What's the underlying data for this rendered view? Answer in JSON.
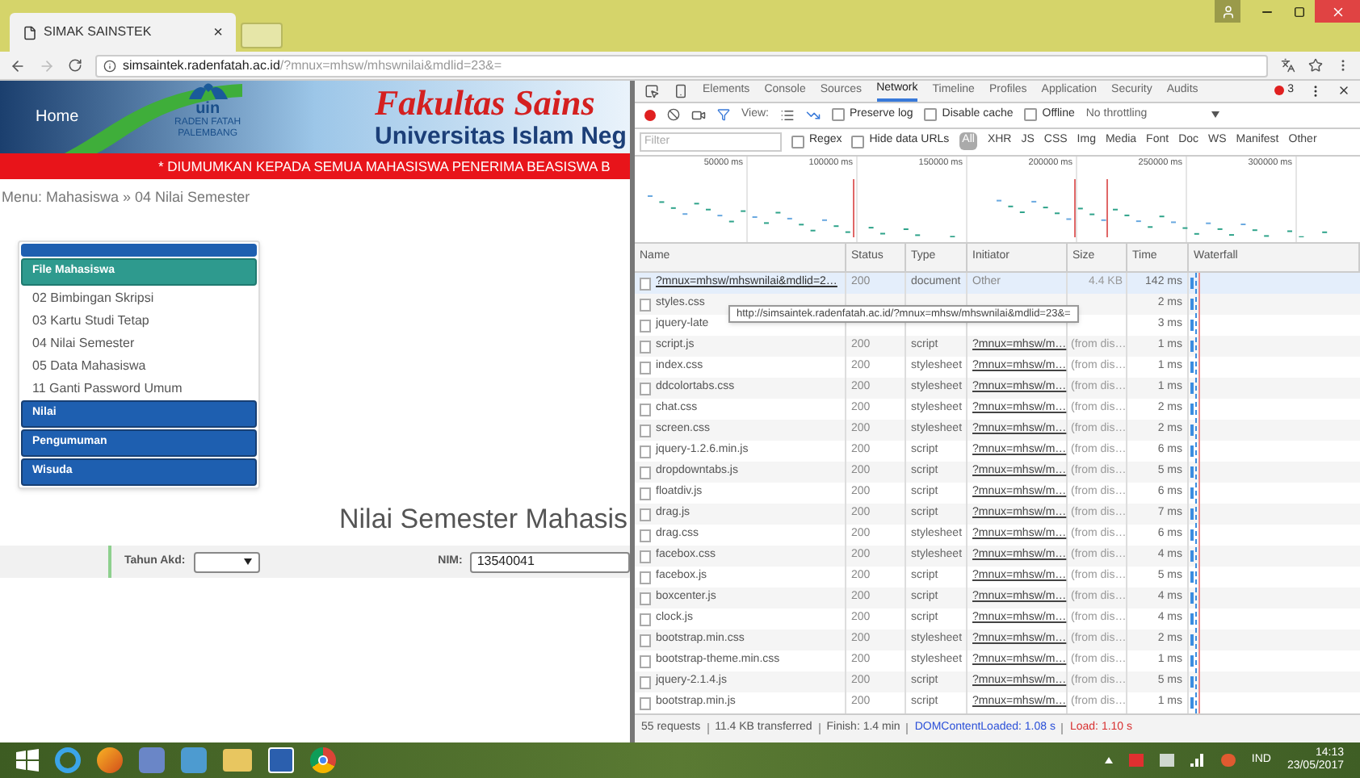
{
  "browser": {
    "tab": {
      "title": "SIMAK SAINSTEK",
      "close": "×"
    },
    "address": {
      "host": "simsaintek.radenfatah.ac.id",
      "path": "/?mnux=mhsw/mhswnilai&mdlid=23&="
    }
  },
  "page": {
    "banner": {
      "home": "Home",
      "logo": [
        "uin",
        "RADEN FATAH",
        "PALEMBANG"
      ],
      "title": "Fakultas Sains",
      "subtitle": "Universitas Islam Neg"
    },
    "marquee": "* DIUMUMKAN KEPADA SEMUA MAHASISWA PENERIMA BEASISWA B",
    "breadcrumb": "Menu: Mahasiswa » 04 Nilai Semester",
    "sidebar": [
      {
        "label": "File Mahasiswa",
        "expanded": true,
        "children": [
          "02 Bimbingan Skripsi",
          "03 Kartu Studi Tetap",
          "04 Nilai Semester",
          "05 Data Mahasiswa",
          "11 Ganti Password Umum"
        ]
      },
      {
        "label": "Nilai",
        "expanded": false
      },
      {
        "label": "Pengumuman",
        "expanded": false
      },
      {
        "label": "Wisuda",
        "expanded": false
      }
    ],
    "heading": "Nilai Semester Mahasis",
    "form": {
      "year_label": "Tahun Akd:",
      "nim_label": "NIM:",
      "nim_value": "13540041"
    }
  },
  "devtools": {
    "tabs": [
      {
        "label": "Elements",
        "selected": false
      },
      {
        "label": "Console",
        "selected": false
      },
      {
        "label": "Sources",
        "selected": false
      },
      {
        "label": "Network",
        "selected": true
      },
      {
        "label": "Timeline",
        "selected": false
      },
      {
        "label": "Profiles",
        "selected": false
      },
      {
        "label": "Application",
        "selected": false
      },
      {
        "label": "Security",
        "selected": false
      },
      {
        "label": "Audits",
        "selected": false
      }
    ],
    "error_count": "3",
    "toolbar": {
      "view_label": "View:",
      "preserve_log": {
        "label": "Preserve log",
        "checked": false
      },
      "disable_cache": {
        "label": "Disable cache",
        "checked": false
      },
      "offline": {
        "label": "Offline",
        "checked": false
      },
      "throttling": "No throttling"
    },
    "filter": {
      "placeholder": "Filter",
      "regex": {
        "label": "Regex",
        "checked": false
      },
      "hide_data_urls": {
        "label": "Hide data URLs",
        "checked": false
      },
      "types": [
        {
          "label": "All",
          "selected": true
        },
        {
          "label": "XHR",
          "selected": false
        },
        {
          "label": "JS",
          "selected": false
        },
        {
          "label": "CSS",
          "selected": false
        },
        {
          "label": "Img",
          "selected": false
        },
        {
          "label": "Media",
          "selected": false
        },
        {
          "label": "Font",
          "selected": false
        },
        {
          "label": "Doc",
          "selected": false
        },
        {
          "label": "WS",
          "selected": false
        },
        {
          "label": "Manifest",
          "selected": false
        },
        {
          "label": "Other",
          "selected": false
        }
      ]
    },
    "overview_ticks": [
      "50000 ms",
      "100000 ms",
      "150000 ms",
      "200000 ms",
      "250000 ms",
      "300000 ms"
    ],
    "columns": [
      "Name",
      "Status",
      "Type",
      "Initiator",
      "Size",
      "Time",
      "Waterfall"
    ],
    "rows": [
      {
        "name": "?mnux=mhsw/mhswnilai&mdlid=2…",
        "status": "200",
        "type": "document",
        "initiator": {
          "text": "Other",
          "kind": "text"
        },
        "size": "4.4 KB",
        "time": "142 ms",
        "selected": true
      },
      {
        "name": "styles.css",
        "time": "2 ms",
        "selected": false
      },
      {
        "name": "jquery-late",
        "time": "3 ms",
        "selected": false
      },
      {
        "name": "script.js",
        "status": "200",
        "type": "script",
        "initiator": {
          "text": "?mnux=mhsw/m…",
          "kind": "link"
        },
        "size": "(from dis…",
        "time": "1 ms",
        "selected": false
      },
      {
        "name": "index.css",
        "status": "200",
        "type": "stylesheet",
        "initiator": {
          "text": "?mnux=mhsw/m…",
          "kind": "link"
        },
        "size": "(from dis…",
        "time": "1 ms",
        "selected": false
      },
      {
        "name": "ddcolortabs.css",
        "status": "200",
        "type": "stylesheet",
        "initiator": {
          "text": "?mnux=mhsw/m…",
          "kind": "link"
        },
        "size": "(from dis…",
        "time": "1 ms",
        "selected": false
      },
      {
        "name": "chat.css",
        "status": "200",
        "type": "stylesheet",
        "initiator": {
          "text": "?mnux=mhsw/m…",
          "kind": "link"
        },
        "size": "(from dis…",
        "time": "2 ms",
        "selected": false
      },
      {
        "name": "screen.css",
        "status": "200",
        "type": "stylesheet",
        "initiator": {
          "text": "?mnux=mhsw/m…",
          "kind": "link"
        },
        "size": "(from dis…",
        "time": "2 ms",
        "selected": false
      },
      {
        "name": "jquery-1.2.6.min.js",
        "status": "200",
        "type": "script",
        "initiator": {
          "text": "?mnux=mhsw/m…",
          "kind": "link"
        },
        "size": "(from dis…",
        "time": "6 ms",
        "selected": false
      },
      {
        "name": "dropdowntabs.js",
        "status": "200",
        "type": "script",
        "initiator": {
          "text": "?mnux=mhsw/m…",
          "kind": "link"
        },
        "size": "(from dis…",
        "time": "5 ms",
        "selected": false
      },
      {
        "name": "floatdiv.js",
        "status": "200",
        "type": "script",
        "initiator": {
          "text": "?mnux=mhsw/m…",
          "kind": "link"
        },
        "size": "(from dis…",
        "time": "6 ms",
        "selected": false
      },
      {
        "name": "drag.js",
        "status": "200",
        "type": "script",
        "initiator": {
          "text": "?mnux=mhsw/m…",
          "kind": "link"
        },
        "size": "(from dis…",
        "time": "7 ms",
        "selected": false
      },
      {
        "name": "drag.css",
        "status": "200",
        "type": "stylesheet",
        "initiator": {
          "text": "?mnux=mhsw/m…",
          "kind": "link"
        },
        "size": "(from dis…",
        "time": "6 ms",
        "selected": false
      },
      {
        "name": "facebox.css",
        "status": "200",
        "type": "stylesheet",
        "initiator": {
          "text": "?mnux=mhsw/m…",
          "kind": "link"
        },
        "size": "(from dis…",
        "time": "4 ms",
        "selected": false
      },
      {
        "name": "facebox.js",
        "status": "200",
        "type": "script",
        "initiator": {
          "text": "?mnux=mhsw/m…",
          "kind": "link"
        },
        "size": "(from dis…",
        "time": "5 ms",
        "selected": false
      },
      {
        "name": "boxcenter.js",
        "status": "200",
        "type": "script",
        "initiator": {
          "text": "?mnux=mhsw/m…",
          "kind": "link"
        },
        "size": "(from dis…",
        "time": "4 ms",
        "selected": false
      },
      {
        "name": "clock.js",
        "status": "200",
        "type": "script",
        "initiator": {
          "text": "?mnux=mhsw/m…",
          "kind": "link"
        },
        "size": "(from dis…",
        "time": "4 ms",
        "selected": false
      },
      {
        "name": "bootstrap.min.css",
        "status": "200",
        "type": "stylesheet",
        "initiator": {
          "text": "?mnux=mhsw/m…",
          "kind": "link"
        },
        "size": "(from dis…",
        "time": "2 ms",
        "selected": false
      },
      {
        "name": "bootstrap-theme.min.css",
        "status": "200",
        "type": "stylesheet",
        "initiator": {
          "text": "?mnux=mhsw/m…",
          "kind": "link"
        },
        "size": "(from dis…",
        "time": "1 ms",
        "selected": false
      },
      {
        "name": "jquery-2.1.4.js",
        "status": "200",
        "type": "script",
        "initiator": {
          "text": "?mnux=mhsw/m…",
          "kind": "link"
        },
        "size": "(from dis…",
        "time": "5 ms",
        "selected": false
      },
      {
        "name": "bootstrap.min.js",
        "status": "200",
        "type": "script",
        "initiator": {
          "text": "?mnux=mhsw/m…",
          "kind": "link"
        },
        "size": "(from dis…",
        "time": "1 ms",
        "selected": false
      }
    ],
    "tooltip": "http://simsaintek.radenfatah.ac.id/?mnux=mhsw/mhswnilai&mdlid=23&=",
    "summary": [
      {
        "text": "55 requests",
        "kind": "plain"
      },
      {
        "text": "11.4 KB transferred",
        "kind": "plain"
      },
      {
        "text": "Finish: 1.4 min",
        "kind": "plain"
      },
      {
        "text": "DOMContentLoaded: 1.08 s",
        "kind": "dom"
      },
      {
        "text": "Load: 1.10 s",
        "kind": "load"
      }
    ]
  },
  "taskbar": {
    "language": "IND",
    "time": "14:13",
    "date": "23/05/2017"
  }
}
